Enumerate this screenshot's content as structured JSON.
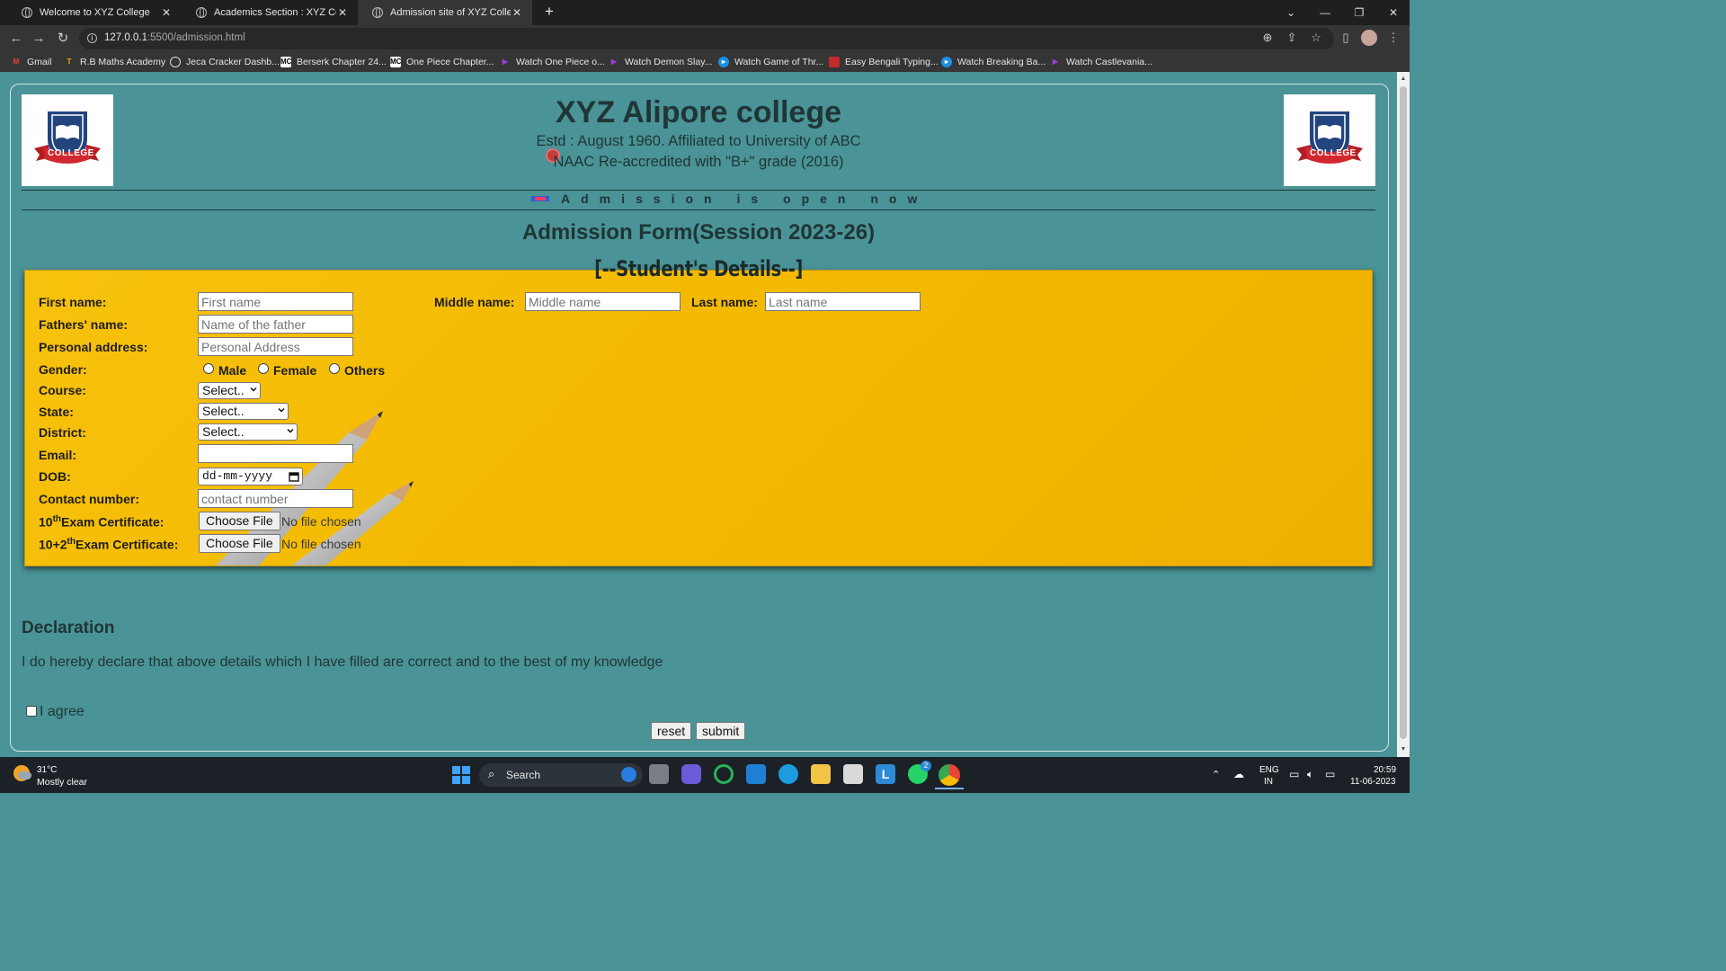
{
  "browser": {
    "tabs": [
      {
        "title": "Welcome to XYZ College",
        "active": false
      },
      {
        "title": "Academics Section : XYZ College",
        "active": false
      },
      {
        "title": "Admission site of XYZ College",
        "active": true
      }
    ],
    "url_host": "127.0.0.1",
    "url_path": ":5500/admission.html",
    "bookmarks": [
      {
        "label": "Gmail",
        "icon": "gmail-icon"
      },
      {
        "label": "R.B Maths Academy",
        "icon": "rb-icon"
      },
      {
        "label": "Jeca Cracker Dashb...",
        "icon": "jeca-icon"
      },
      {
        "label": "Berserk Chapter 24...",
        "icon": "mc-icon"
      },
      {
        "label": "One Piece Chapter...",
        "icon": "mc-icon"
      },
      {
        "label": "Watch One Piece o...",
        "icon": "play-icon"
      },
      {
        "label": "Watch Demon Slay...",
        "icon": "play-icon"
      },
      {
        "label": "Watch Game of Thr...",
        "icon": "circle-play-icon"
      },
      {
        "label": "Easy Bengali Typing...",
        "icon": "red-icon"
      },
      {
        "label": "Watch Breaking Ba...",
        "icon": "circle-play-icon"
      },
      {
        "label": "Watch Castlevania...",
        "icon": "play-icon"
      }
    ]
  },
  "header": {
    "college_name": "XYZ Alipore college",
    "estd": "Estd : August 1960. Affiliated to University of ABC",
    "naac": "NAAC Re-accredited with \"B+\" grade (2016)",
    "logo_text": "COLLEGE",
    "marquee": "Admission is open now"
  },
  "form": {
    "title": "Admission Form(Session 2023-26)",
    "subtitle": "[--Student's Details--]",
    "labels": {
      "first_name": "First name:",
      "middle_name": "Middle name:",
      "last_name": "Last name:",
      "fathers_name": "Fathers' name:",
      "address": "Personal address:",
      "gender": "Gender:",
      "course": "Course:",
      "state": "State:",
      "district": "District:",
      "email": "Email:",
      "dob": "DOB:",
      "contact": "Contact number:",
      "cert10_pre": "10",
      "cert10_sup": "th",
      "cert10_post": "Exam Certificate:",
      "cert12_pre": "10+2",
      "cert12_sup": "th",
      "cert12_post": "Exam Certificate:"
    },
    "placeholders": {
      "first_name": "First name",
      "middle_name": "Middle name",
      "last_name": "Last name",
      "fathers_name": "Name of the father",
      "address": "Personal Address",
      "email": "",
      "contact": "contact number"
    },
    "gender_options": [
      "Male",
      "Female",
      "Others"
    ],
    "course_value": "Select..",
    "state_value": "Select..",
    "district_value": "Select..",
    "dob_value": "dd-mm-yyyy",
    "file_button": "Choose File",
    "file_status": "No file chosen"
  },
  "declaration": {
    "heading": "Declaration",
    "text": "I do hereby declare that above details which I have filled are correct and to the best of my knowledge",
    "agree": "I agree",
    "reset": "reset",
    "submit": "submit"
  },
  "taskbar": {
    "temperature": "31°C",
    "weather": "Mostly clear",
    "search": "Search",
    "lang1": "ENG",
    "lang2": "IN",
    "time": "20:59",
    "date": "11-06-2023",
    "whatsapp_badge": "2"
  }
}
